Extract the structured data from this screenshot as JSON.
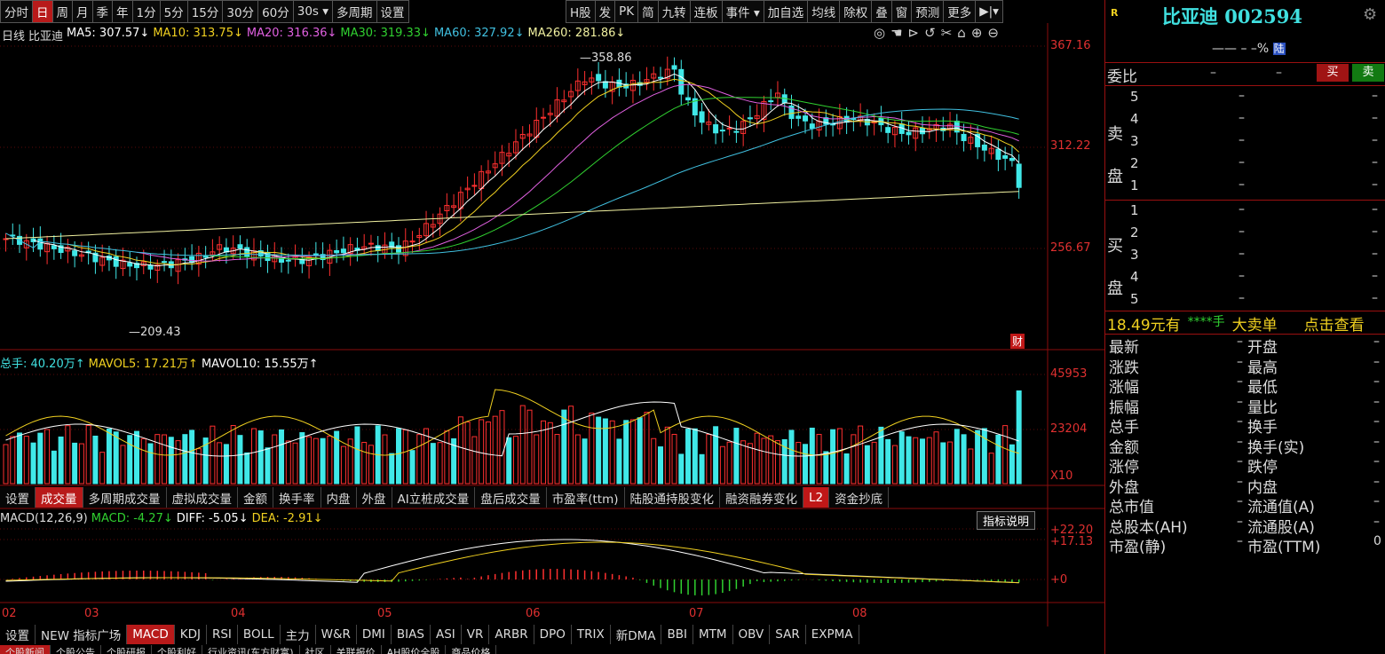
{
  "toolbar": {
    "left_items": [
      "分时",
      "日",
      "周",
      "月",
      "季",
      "年",
      "1分",
      "5分",
      "15分",
      "30分",
      "60分",
      "30s ▾",
      "多周期",
      "设置"
    ],
    "active_index": 1,
    "right_items": [
      "H股",
      "发",
      "PK",
      "简",
      "九转",
      "连板",
      "事件 ▾",
      "加自选",
      "均线",
      "除权",
      "叠",
      "窗",
      "预测",
      "更多",
      "▶|▾"
    ]
  },
  "chart_legend": {
    "period": "日线",
    "name": "比亚迪",
    "ma": [
      {
        "label": "MA5: 307.57↓",
        "color": "#ffffff"
      },
      {
        "label": "MA10: 313.75↓",
        "color": "#f0d020"
      },
      {
        "label": "MA20: 316.36↓",
        "color": "#e060e0"
      },
      {
        "label": "MA30: 319.33↓",
        "color": "#30d030"
      },
      {
        "label": "MA60: 327.92↓",
        "color": "#40c0e0"
      },
      {
        "label": "MA260: 281.86↓",
        "color": "#f0f0a0"
      }
    ]
  },
  "price_axis": {
    "labels": [
      "367.16",
      "312.22",
      "256.67"
    ]
  },
  "price_annotations": {
    "high": "358.86",
    "low": "209.43",
    "fin_badge": "财"
  },
  "volume_legend": [
    {
      "label": "总手: 40.20万↑",
      "color": "#40e0e0"
    },
    {
      "label": "MAVOL5: 17.21万↑",
      "color": "#f0d020"
    },
    {
      "label": "MAVOL10: 15.55万↑",
      "color": "#ffffff"
    }
  ],
  "volume_axis": {
    "labels": [
      "45953",
      "23204",
      "X10"
    ]
  },
  "indicator_tabs": {
    "items": [
      "设置",
      "成交量",
      "多周期成交量",
      "虚拟成交量",
      "金额",
      "换手率",
      "内盘",
      "外盘",
      "AI立桩成交量",
      "盘后成交量",
      "市盈率(ttm)",
      "陆股通持股变化",
      "融资融券变化",
      "L2",
      "资金抄底"
    ],
    "active_index": 1
  },
  "macd_legend": [
    {
      "label": "MACD(12,26,9)",
      "color": "#dcdcdc"
    },
    {
      "label": "MACD: -4.27↓",
      "color": "#30d030"
    },
    {
      "label": "DIFF: -5.05↓",
      "color": "#ffffff"
    },
    {
      "label": "DEA: -2.91↓",
      "color": "#f0d020"
    }
  ],
  "macd_axis": {
    "labels": [
      "+22.20",
      "+17.13",
      "+0"
    ]
  },
  "macd_help": "指标说明",
  "months": [
    "02",
    "03",
    "04",
    "05",
    "06",
    "07",
    "08"
  ],
  "indicator_list": {
    "items": [
      "设置",
      "NEW 指标广场",
      "MACD",
      "KDJ",
      "RSI",
      "BOLL",
      "主力",
      "W&R",
      "DMI",
      "BIAS",
      "ASI",
      "VR",
      "ARBR",
      "DPO",
      "TRIX",
      "新DMA",
      "BBI",
      "MTM",
      "OBV",
      "SAR",
      "EXPMA"
    ],
    "active_index": 2
  },
  "bottom_tabs": [
    "个股新闻",
    "个股公告",
    "个股研报",
    "个股利好",
    "行业资讯(东方财富)",
    "社区",
    "关联报价",
    "AH股价全股",
    "商品价格"
  ],
  "quote": {
    "badge": "R",
    "title": "比亚迪 002594",
    "sub": "—— – –% ",
    "sub_badge": "陆",
    "committee_label": "委比",
    "committee_vals": [
      "–",
      "–"
    ],
    "buy_btn": "买",
    "sell_btn": "卖",
    "sell_label": "卖盘",
    "buy_label": "买盘",
    "levels": [
      "5",
      "4",
      "3",
      "2",
      "1"
    ],
    "buy_levels": [
      "1",
      "2",
      "3",
      "4",
      "5"
    ],
    "dash": "–",
    "big_order": {
      "price": "18.49元有",
      "stars": "****手",
      "text": "大卖单",
      "link": "点击查看"
    },
    "stats_left": [
      "最新",
      "涨跌",
      "涨幅",
      "振幅",
      "总手",
      "金额",
      "涨停",
      "外盘",
      "总市值",
      "总股本(AH)",
      "市盈(静)"
    ],
    "stats_right": [
      "开盘",
      "最高",
      "最低",
      "量比",
      "换手",
      "换手(实)",
      "跌停",
      "内盘",
      "流通值(A)",
      "流通股(A)",
      "市盈(TTM)"
    ],
    "stats_right_val_last": "0"
  }
}
